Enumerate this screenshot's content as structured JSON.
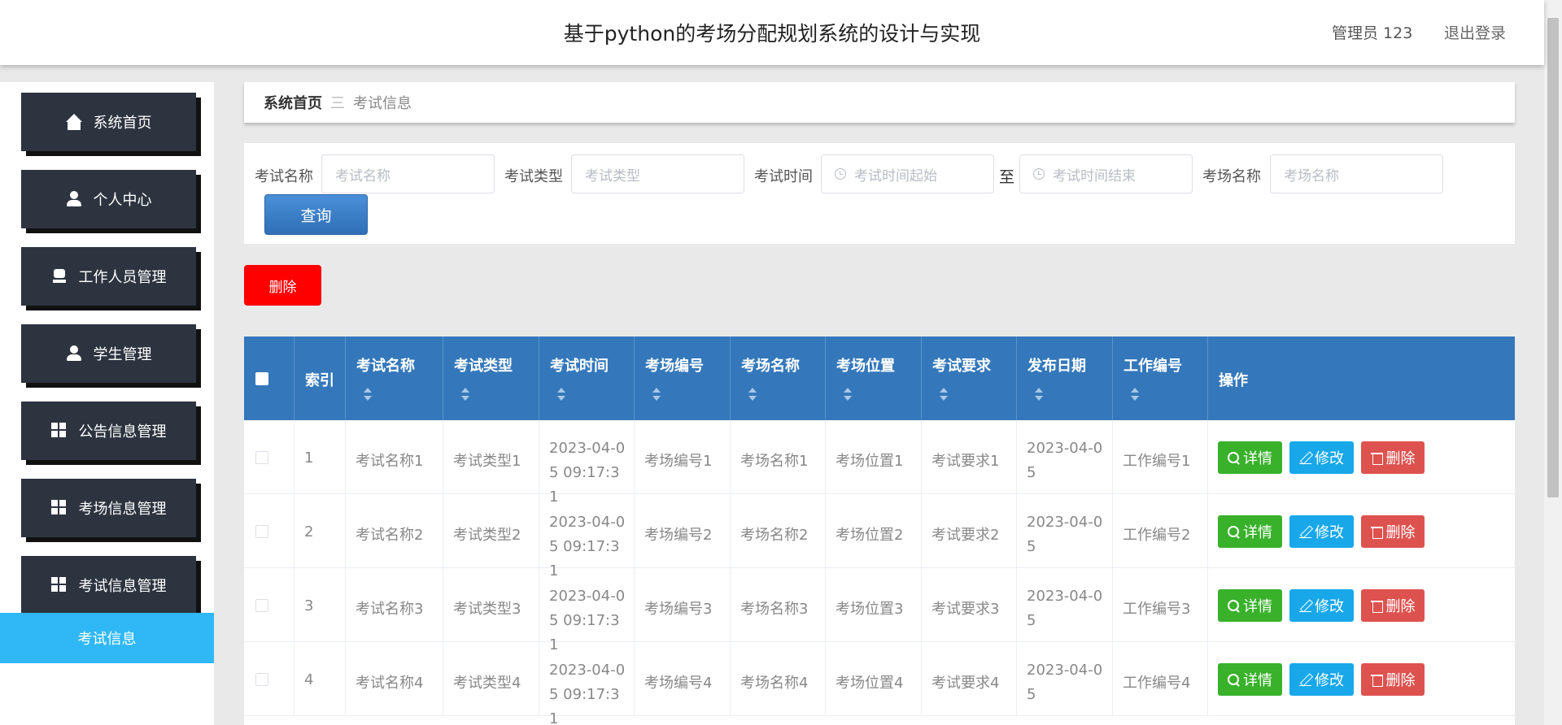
{
  "header": {
    "title": "基于python的考场分配规划系统的设计与实现",
    "user": "管理员 123",
    "logout": "退出登录"
  },
  "sidebar": {
    "items": [
      {
        "label": "系统首页",
        "icon": "home-icon"
      },
      {
        "label": "个人中心",
        "icon": "user-icon"
      },
      {
        "label": "工作人员管理",
        "icon": "seat-icon"
      },
      {
        "label": "学生管理",
        "icon": "user-icon"
      },
      {
        "label": "公告信息管理",
        "icon": "grid-icon"
      },
      {
        "label": "考场信息管理",
        "icon": "grid-icon"
      },
      {
        "label": "考试信息管理",
        "icon": "grid-icon"
      }
    ],
    "active_sub": "考试信息"
  },
  "breadcrumb": {
    "home": "系统首页",
    "separator": "三",
    "current": "考试信息"
  },
  "search": {
    "exam_name_label": "考试名称",
    "exam_name_placeholder": "考试名称",
    "exam_type_label": "考试类型",
    "exam_type_placeholder": "考试类型",
    "exam_time_label": "考试时间",
    "exam_time_start_placeholder": "考试时间起始",
    "to": "至",
    "exam_time_end_placeholder": "考试时间结束",
    "room_name_label": "考场名称",
    "room_name_placeholder": "考场名称",
    "query_button": "查询"
  },
  "actions": {
    "delete_button": "删除"
  },
  "table": {
    "columns": [
      "索引",
      "考试名称",
      "考试类型",
      "考试时间",
      "考场编号",
      "考场名称",
      "考场位置",
      "考试要求",
      "发布日期",
      "工作编号",
      "操作"
    ],
    "row_buttons": {
      "detail": "详情",
      "edit": "修改",
      "delete": "删除"
    },
    "rows": [
      {
        "index": "1",
        "exam_name": "考试名称1",
        "exam_type": "考试类型1",
        "exam_time": "2023-04-05 09:17:31",
        "room_no": "考场编号1",
        "room_name": "考场名称1",
        "room_location": "考场位置1",
        "requirement": "考试要求1",
        "publish_date": "2023-04-05",
        "work_no": "工作编号1"
      },
      {
        "index": "2",
        "exam_name": "考试名称2",
        "exam_type": "考试类型2",
        "exam_time": "2023-04-05 09:17:31",
        "room_no": "考场编号2",
        "room_name": "考场名称2",
        "room_location": "考场位置2",
        "requirement": "考试要求2",
        "publish_date": "2023-04-05",
        "work_no": "工作编号2"
      },
      {
        "index": "3",
        "exam_name": "考试名称3",
        "exam_type": "考试类型3",
        "exam_time": "2023-04-05 09:17:31",
        "room_no": "考场编号3",
        "room_name": "考场名称3",
        "room_location": "考场位置3",
        "requirement": "考试要求3",
        "publish_date": "2023-04-05",
        "work_no": "工作编号3"
      },
      {
        "index": "4",
        "exam_name": "考试名称4",
        "exam_type": "考试类型4",
        "exam_time": "2023-04-05 09:17:31",
        "room_no": "考场编号4",
        "room_name": "考场名称4",
        "room_location": "考场位置4",
        "requirement": "考试要求4",
        "publish_date": "2023-04-05",
        "work_no": "工作编号4"
      }
    ]
  },
  "colors": {
    "sidebar_item": "#2d3440",
    "sidebar_active": "#2fb8f5",
    "table_header": "#3478bb",
    "detail_button": "#39b12b",
    "edit_button": "#18a8ea",
    "delete_row_button": "#dd524f",
    "delete_top_button": "#ff0000"
  }
}
